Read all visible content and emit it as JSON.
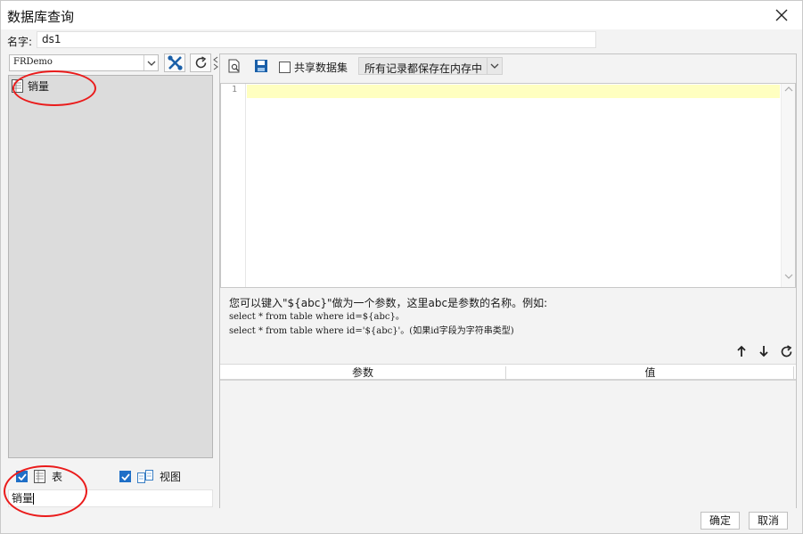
{
  "window": {
    "title": "数据库查询"
  },
  "name_field": {
    "label": "名字:",
    "value": "ds1"
  },
  "left_panel": {
    "datasource": "FRDemo",
    "tree_items": [
      {
        "label": "销量",
        "icon": "table-icon"
      }
    ],
    "checkbox_table": {
      "label": "表",
      "checked": true
    },
    "checkbox_view": {
      "label": "视图",
      "checked": true
    },
    "filter_value": "销量"
  },
  "right_panel": {
    "shared_dataset": {
      "label": "共享数据集",
      "checked": false
    },
    "memory_option": "所有记录都保存在内存中",
    "editor": {
      "line_number": "1",
      "content": ""
    },
    "hint": {
      "line1": "您可以键入\"${abc}\"做为一个参数，这里abc是参数的名称。例如:",
      "line2": "select * from table where id=${abc}。",
      "line3": "select * from table where id='${abc}'。(如果id字段为字符串类型)"
    },
    "param_table": {
      "headers": [
        "参数",
        "值"
      ]
    }
  },
  "footer": {
    "ok": "确定",
    "cancel": "取消"
  },
  "colors": {
    "annotation": "#ea1b1b",
    "checkbox": "#1f6fc7",
    "active_line": "#ffffc0",
    "tree_bg": "#dcdcdc"
  }
}
